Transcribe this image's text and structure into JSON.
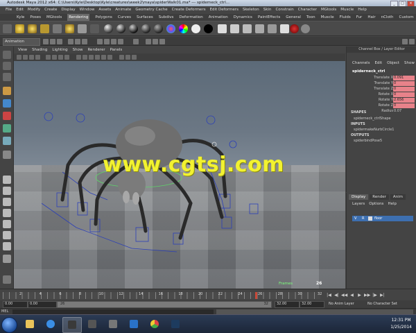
{
  "window": {
    "title": "Autodesk Maya 2012 x64: C:\\Users\\Kyle\\Desktop\\Kyle\\creatures\\week2\\maya\\spiderWalk01.ma* --- spiderneck_ctrl..."
  },
  "menubar": [
    "File",
    "Edit",
    "Modify",
    "Create",
    "Display",
    "Window",
    "Assets",
    "Animate",
    "Geometry Cache",
    "Create Deformers",
    "Edit Deformers",
    "Skeleton",
    "Skin",
    "Constrain",
    "Character",
    "MGtools",
    "Muscle",
    "Help"
  ],
  "shelf_tabs": [
    "Kyle",
    "Poses",
    "MGtools",
    "Rendering",
    "Polygons",
    "Curves",
    "Surfaces",
    "Subdivs",
    "Deformation",
    "Animation",
    "Dynamics",
    "PaintEffects",
    "General",
    "Toon",
    "Muscle",
    "Fluids",
    "Fur",
    "Hair",
    "nCloth",
    "Custom"
  ],
  "active_shelf_tab": "Rendering",
  "status_mode": "Animation",
  "viewport_menu": [
    "View",
    "Shading",
    "Lighting",
    "Show",
    "Renderer",
    "Panels"
  ],
  "viewport": {
    "watermark": "www.cgtsj.com",
    "camera_label": "Frames",
    "frame_number": "26"
  },
  "channel_box": {
    "title": "Channel Box / Layer Editor",
    "menu": [
      "Channels",
      "Edit",
      "Object",
      "Show"
    ],
    "object_name": "spiderneck_ctrl",
    "attributes": [
      {
        "label": "Translate X",
        "value": "0.091"
      },
      {
        "label": "Translate Y",
        "value": "0"
      },
      {
        "label": "Translate Z",
        "value": "0"
      },
      {
        "label": "Rotate X",
        "value": "0"
      },
      {
        "label": "Rotate Y",
        "value": "2.656"
      },
      {
        "label": "Rotate Z",
        "value": "0"
      },
      {
        "label": "Radius",
        "value": "0.07"
      }
    ],
    "shapes_header": "SHAPES",
    "shape_node": "spiderneck_ctrlShape",
    "inputs_header": "INPUTS",
    "input_node": "spidermakeNurbCircle1",
    "outputs_header": "OUTPUTS",
    "output_node": "spiderbindPose5"
  },
  "layer_editor": {
    "tabs": [
      "Display",
      "Render",
      "Anim"
    ],
    "active_tab": "Display",
    "menu": [
      "Layers",
      "Options",
      "Help"
    ],
    "layer": {
      "visible": "V",
      "ref": "R",
      "name": "floor"
    }
  },
  "timeline": {
    "ticks": [
      "2",
      "4",
      "6",
      "8",
      "10",
      "12",
      "14",
      "16",
      "18",
      "20",
      "22",
      "24",
      "26",
      "28",
      "30",
      "32"
    ],
    "current_frame": "26"
  },
  "range": {
    "start": "0.00",
    "playback_start": "0.00",
    "bar_start": "26",
    "bar_end": "32",
    "playback_end": "32.00",
    "end": "32.00",
    "anim_layer": "No Anim Layer",
    "character_set": "No Character Set"
  },
  "command_line": {
    "label": "MEL"
  },
  "taskbar": {
    "time": "12:31 PM",
    "date": "1/25/2014"
  }
}
